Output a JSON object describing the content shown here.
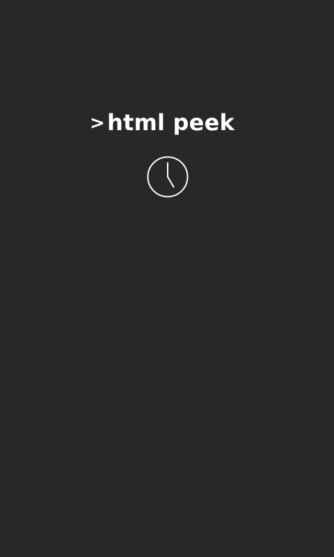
{
  "app": {
    "prompt_symbol": ">",
    "title": "html peek",
    "loading_icon": "clock-icon"
  },
  "colors": {
    "background": "#282828",
    "foreground": "#ffffff"
  }
}
